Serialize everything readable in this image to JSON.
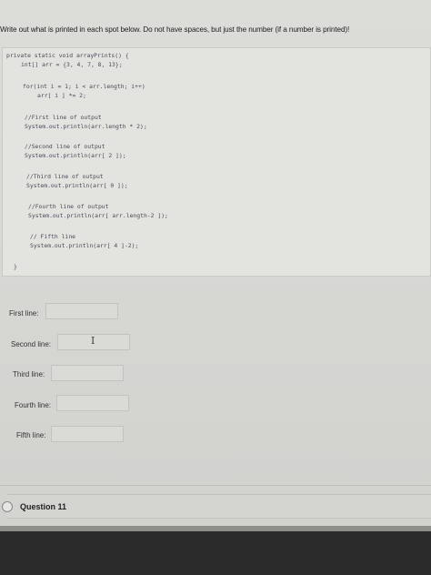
{
  "instruction": "Write out what is printed in each spot below. Do not have spaces, but just the number (if a number is printed)!",
  "code": {
    "signature": "private static void arrayPrints() {",
    "decl": "int[] arr = {3, 4, 7, 8, 13};",
    "for_line": "for(int i = 1; i < arr.length; i++)",
    "for_body": "arr[ i ] *= 2;",
    "c1": "//First line of output",
    "p1": "System.out.println(arr.length * 2);",
    "c2": "//Second line of output",
    "p2": "System.out.println(arr[ 2 ]);",
    "c3": "//Third line of output",
    "p3": "System.out.println(arr[ 0 ]);",
    "c4": "//Fourth line of output",
    "p4": "System.out.println(arr[ arr.length-2 ]);",
    "c5": "// Fifth line",
    "p5": "System.out.println(arr[ 4 ]-2);",
    "close": "}"
  },
  "fields": {
    "first": {
      "label": "First line:",
      "value": ""
    },
    "second": {
      "label": "Second line:",
      "value": ""
    },
    "third": {
      "label": "Third line:",
      "value": ""
    },
    "fourth": {
      "label": "Fourth line:",
      "value": ""
    },
    "fifth": {
      "label": "Fifth line:",
      "value": ""
    }
  },
  "cursor_glyph": "I",
  "question": {
    "title": "Question 11"
  }
}
